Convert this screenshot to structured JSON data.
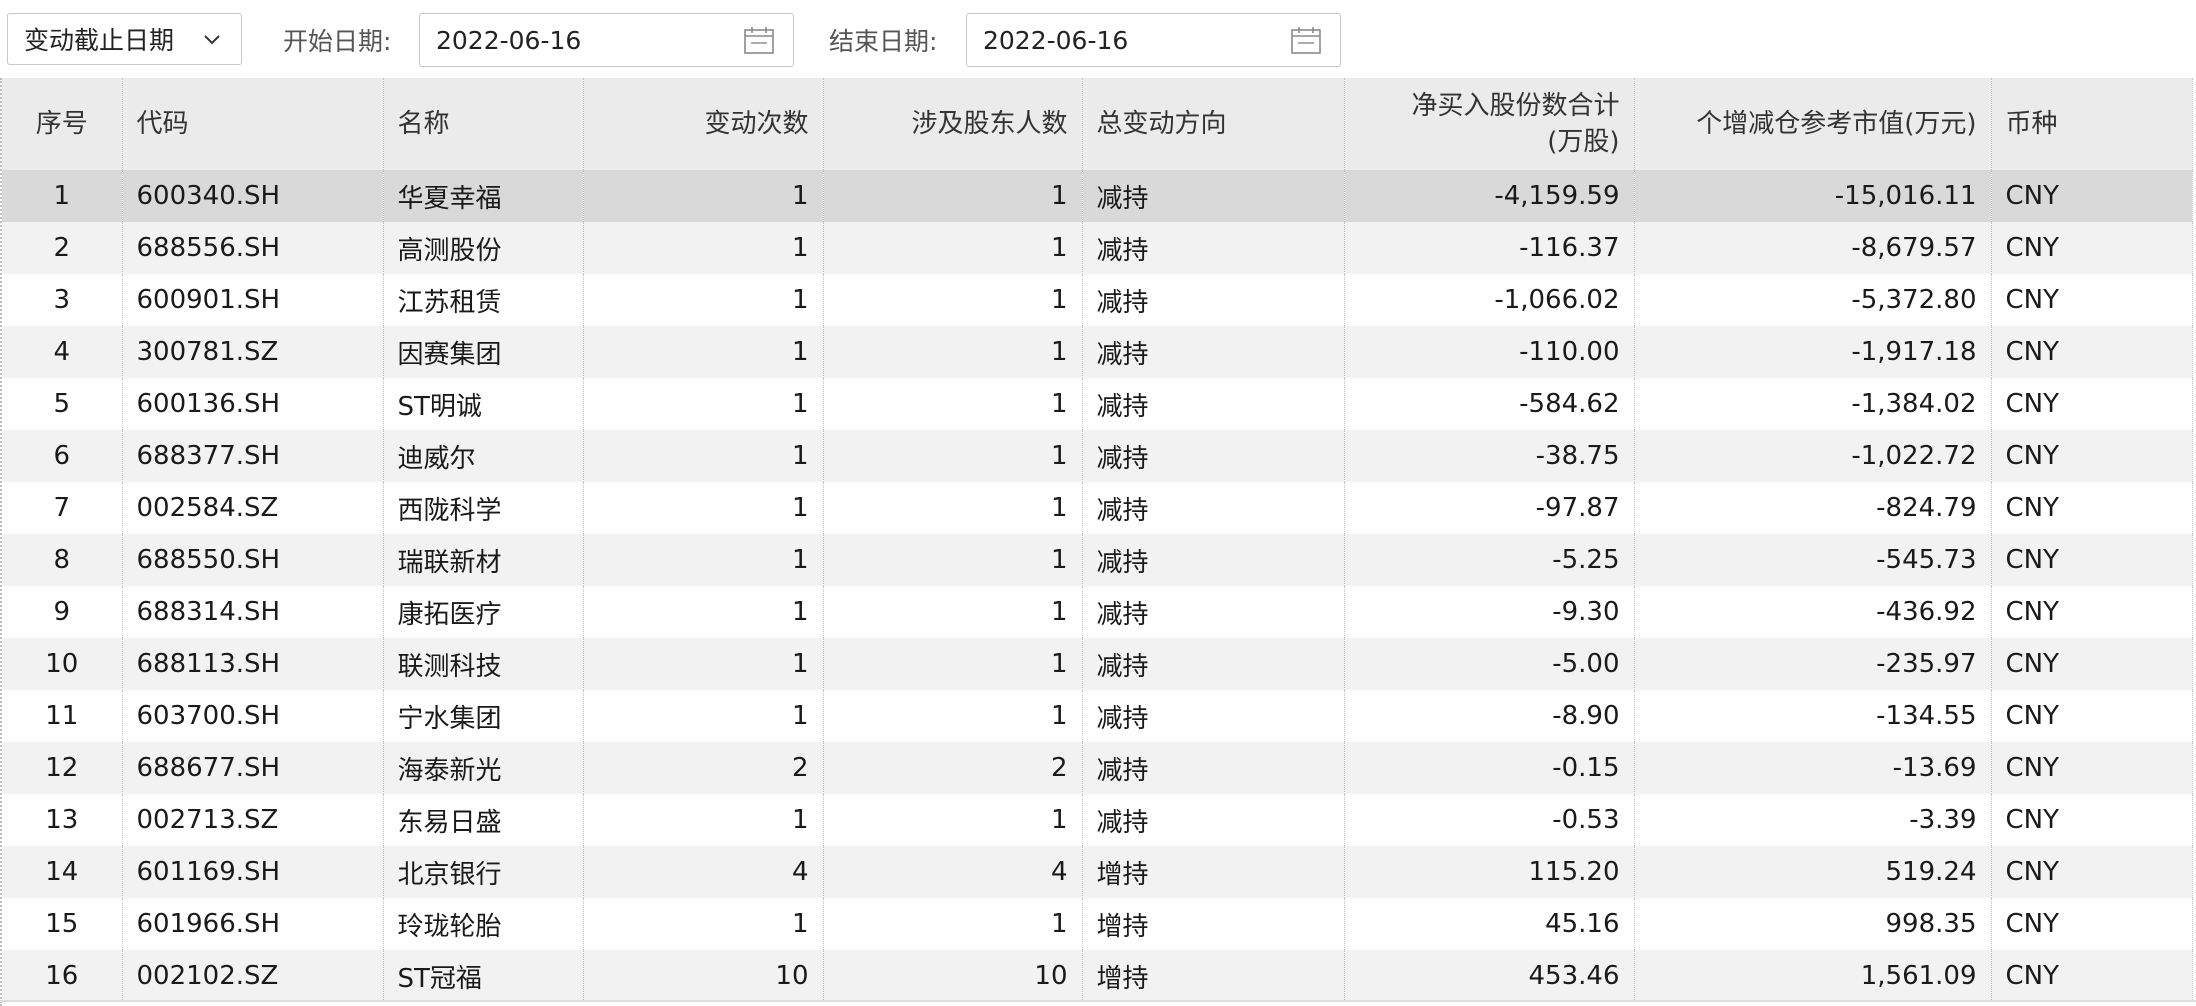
{
  "toolbar": {
    "period_select": "变动截止日期",
    "start_label": "开始日期:",
    "start_value": "2022-06-16",
    "end_label": "结束日期:",
    "end_value": "2022-06-16",
    "icons": [
      "chevron-down-icon",
      "calendar-icon"
    ]
  },
  "table": {
    "headers": [
      "序号",
      "代码",
      "名称",
      "变动次数",
      "涉及股东人数",
      "总变动方向",
      "净买入股份数合计(万股)",
      "个增减仓参考市值(万元)",
      "币种"
    ],
    "header_net_line1": "净买入股份数合计",
    "header_net_line2": "(万股)",
    "rows": [
      {
        "no": "1",
        "code": "600340.SH",
        "name": "华夏幸福",
        "times": "1",
        "holders": "1",
        "direction": "减持",
        "net": "-4,159.59",
        "value": "-15,016.11",
        "currency": "CNY"
      },
      {
        "no": "2",
        "code": "688556.SH",
        "name": "高测股份",
        "times": "1",
        "holders": "1",
        "direction": "减持",
        "net": "-116.37",
        "value": "-8,679.57",
        "currency": "CNY"
      },
      {
        "no": "3",
        "code": "600901.SH",
        "name": "江苏租赁",
        "times": "1",
        "holders": "1",
        "direction": "减持",
        "net": "-1,066.02",
        "value": "-5,372.80",
        "currency": "CNY"
      },
      {
        "no": "4",
        "code": "300781.SZ",
        "name": "因赛集团",
        "times": "1",
        "holders": "1",
        "direction": "减持",
        "net": "-110.00",
        "value": "-1,917.18",
        "currency": "CNY"
      },
      {
        "no": "5",
        "code": "600136.SH",
        "name": "ST明诚",
        "times": "1",
        "holders": "1",
        "direction": "减持",
        "net": "-584.62",
        "value": "-1,384.02",
        "currency": "CNY"
      },
      {
        "no": "6",
        "code": "688377.SH",
        "name": "迪威尔",
        "times": "1",
        "holders": "1",
        "direction": "减持",
        "net": "-38.75",
        "value": "-1,022.72",
        "currency": "CNY"
      },
      {
        "no": "7",
        "code": "002584.SZ",
        "name": "西陇科学",
        "times": "1",
        "holders": "1",
        "direction": "减持",
        "net": "-97.87",
        "value": "-824.79",
        "currency": "CNY"
      },
      {
        "no": "8",
        "code": "688550.SH",
        "name": "瑞联新材",
        "times": "1",
        "holders": "1",
        "direction": "减持",
        "net": "-5.25",
        "value": "-545.73",
        "currency": "CNY"
      },
      {
        "no": "9",
        "code": "688314.SH",
        "name": "康拓医疗",
        "times": "1",
        "holders": "1",
        "direction": "减持",
        "net": "-9.30",
        "value": "-436.92",
        "currency": "CNY"
      },
      {
        "no": "10",
        "code": "688113.SH",
        "name": "联测科技",
        "times": "1",
        "holders": "1",
        "direction": "减持",
        "net": "-5.00",
        "value": "-235.97",
        "currency": "CNY"
      },
      {
        "no": "11",
        "code": "603700.SH",
        "name": "宁水集团",
        "times": "1",
        "holders": "1",
        "direction": "减持",
        "net": "-8.90",
        "value": "-134.55",
        "currency": "CNY"
      },
      {
        "no": "12",
        "code": "688677.SH",
        "name": "海泰新光",
        "times": "2",
        "holders": "2",
        "direction": "减持",
        "net": "-0.15",
        "value": "-13.69",
        "currency": "CNY"
      },
      {
        "no": "13",
        "code": "002713.SZ",
        "name": "东易日盛",
        "times": "1",
        "holders": "1",
        "direction": "减持",
        "net": "-0.53",
        "value": "-3.39",
        "currency": "CNY"
      },
      {
        "no": "14",
        "code": "601169.SH",
        "name": "北京银行",
        "times": "4",
        "holders": "4",
        "direction": "增持",
        "net": "115.20",
        "value": "519.24",
        "currency": "CNY"
      },
      {
        "no": "15",
        "code": "601966.SH",
        "name": "玲珑轮胎",
        "times": "1",
        "holders": "1",
        "direction": "增持",
        "net": "45.16",
        "value": "998.35",
        "currency": "CNY"
      },
      {
        "no": "16",
        "code": "002102.SZ",
        "name": "ST冠福",
        "times": "10",
        "holders": "10",
        "direction": "增持",
        "net": "453.46",
        "value": "1,561.09",
        "currency": "CNY"
      }
    ]
  }
}
